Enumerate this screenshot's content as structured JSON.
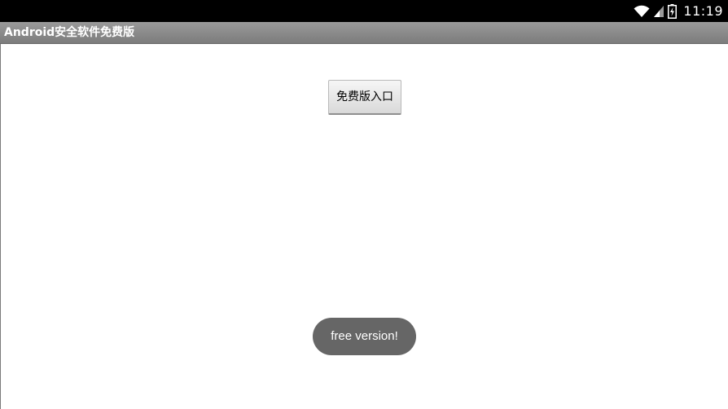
{
  "status_bar": {
    "time": "11:19",
    "icons": [
      "wifi-icon",
      "signal-icon",
      "battery-charging-icon"
    ]
  },
  "action_bar": {
    "title": "Android安全软件免费版"
  },
  "main": {
    "free_entry_button_label": "免费版入口"
  },
  "toast": {
    "message": "free version!"
  },
  "colors": {
    "status_bar_bg": "#000000",
    "action_bar_bg": "#8a8a8a",
    "toast_bg": "#666666",
    "content_bg": "#ffffff"
  }
}
